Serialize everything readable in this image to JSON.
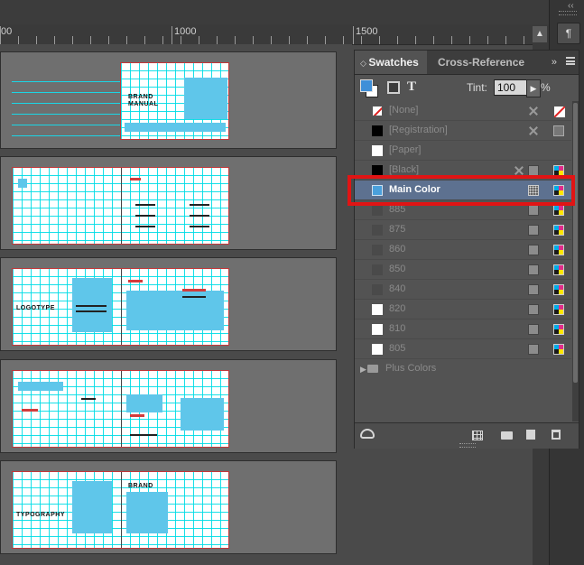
{
  "ruler": {
    "marks": [
      "00",
      "1000",
      "1500"
    ]
  },
  "panel": {
    "tabs": [
      {
        "label": "Swatches",
        "active": true
      },
      {
        "label": "Cross-Reference",
        "active": false
      }
    ],
    "more_tabs_glyph": "»",
    "tint": {
      "label": "Tint:",
      "value": "100",
      "unit": "%"
    },
    "text_glyph": "T",
    "swatches": [
      {
        "name": "[None]",
        "chip": "none",
        "icons": [
          "no-edit",
          "none-mode"
        ]
      },
      {
        "name": "[Registration]",
        "chip": "#000000",
        "icons": [
          "no-edit",
          "registration"
        ]
      },
      {
        "name": "[Paper]",
        "chip": "#ffffff",
        "icons": []
      },
      {
        "name": "[Black]",
        "chip": "#000000",
        "icons": [
          "no-edit",
          "process",
          "cmyk"
        ]
      },
      {
        "name": "Main Color",
        "chip": "#4aa0dc",
        "icons": [
          "spot",
          "cmyk"
        ],
        "selected": true
      },
      {
        "name": "885",
        "chip": "#4a4a4a",
        "icons": [
          "process",
          "cmyk"
        ]
      },
      {
        "name": "875",
        "chip": "#4a4a4a",
        "icons": [
          "process",
          "cmyk"
        ]
      },
      {
        "name": "860",
        "chip": "#4a4a4a",
        "icons": [
          "process",
          "cmyk"
        ]
      },
      {
        "name": "850",
        "chip": "#4a4a4a",
        "icons": [
          "process",
          "cmyk"
        ]
      },
      {
        "name": "840",
        "chip": "#4a4a4a",
        "icons": [
          "process",
          "cmyk"
        ]
      },
      {
        "name": "820",
        "chip": "#ffffff",
        "icons": [
          "process",
          "cmyk"
        ]
      },
      {
        "name": "810",
        "chip": "#ffffff",
        "icons": [
          "process",
          "cmyk"
        ]
      },
      {
        "name": "805",
        "chip": "#ffffff",
        "icons": [
          "process",
          "cmyk"
        ]
      }
    ],
    "group": {
      "name": "Plus Colors"
    }
  },
  "thumbnails": {
    "cover_title": [
      "BRAND",
      "MANUAL"
    ],
    "logo_title": "LOGOTYPE",
    "typo_title": "TYPOGRAPHY",
    "brand_heading": "BRAND"
  },
  "colors": {
    "highlight": "#e11414",
    "selection": "#5d7190",
    "guide": "#1ad6e6",
    "fill": "#5fc6ea"
  }
}
